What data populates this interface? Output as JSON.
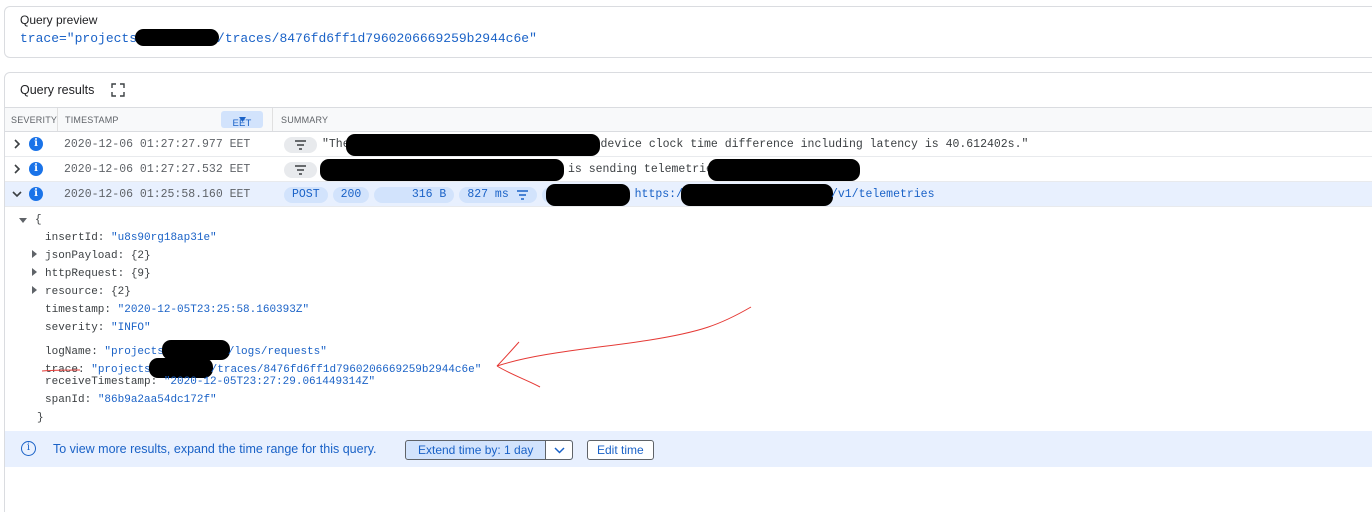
{
  "preview": {
    "title": "Query preview",
    "query_prefix": "trace=\"projects",
    "query_suffix": "/traces/8476fd6ff1d7960206669259b2944c6e\""
  },
  "results": {
    "title": "Query results",
    "columns": {
      "severity": "SEVERITY",
      "timestamp": "TIMESTAMP",
      "timezone": "EET",
      "summary": "SUMMARY"
    },
    "rows": [
      {
        "timestamp": "2020-12-06 01:27:27.977 EET",
        "summary_start": "\"The",
        "summary_end": " device clock time difference including latency is 40.612402s.\""
      },
      {
        "timestamp": "2020-12-06 01:27:27.532 EET",
        "summary_mid": "is sending telemetries"
      },
      {
        "timestamp": "2020-12-06 01:25:58.160 EET",
        "method": "POST",
        "status": "200",
        "size": "316 B",
        "latency": "827 ms",
        "url_start": "https:/",
        "url_end": "/v1/telemetries"
      }
    ],
    "json": {
      "open": "{",
      "close": "}",
      "insertId_key": "insertId:",
      "insertId_val": "\"u8s90rg18ap31e\"",
      "jsonPayload": "jsonPayload: {2}",
      "httpRequest": "httpRequest: {9}",
      "resource": "resource: {2}",
      "timestamp_key": "timestamp:",
      "timestamp_val": "\"2020-12-05T23:25:58.160393Z\"",
      "severity_key": "severity:",
      "severity_val": "\"INFO\"",
      "logName_key": "logName:",
      "logName_val_start": "\"projects",
      "logName_val_end": "/logs/requests\"",
      "trace_key": "trace",
      "trace_colon": ":",
      "trace_val_start": "\"projects",
      "trace_val_end": "/traces/8476fd6ff1d7960206669259b2944c6e\"",
      "receiveTimestamp_key": "receiveTimestamp:",
      "receiveTimestamp_val": "\"2020-12-05T23:27:29.061449314Z\"",
      "spanId_key": "spanId:",
      "spanId_val": "\"86b9a2aa54dc172f\""
    },
    "banner": {
      "message": "To view more results, expand the time range for this query.",
      "extend_label": "Extend time by: 1 day",
      "edit_label": "Edit time"
    }
  },
  "colors": {
    "accent": "#1a73e8",
    "link": "#1a62c7",
    "annotation": "#e53935"
  }
}
